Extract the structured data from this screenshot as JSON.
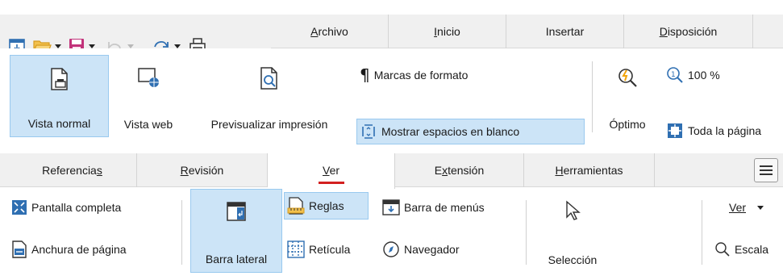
{
  "top": {
    "tabs": [
      {
        "label": "Archivo",
        "u": "A",
        "rest": "rchivo"
      },
      {
        "label": "Inicio",
        "u": "I",
        "rest": "nicio"
      },
      {
        "label": "Insertar",
        "u": "",
        "rest": "Insertar"
      },
      {
        "label": "Disposición",
        "u": "D",
        "rest": "isposición"
      }
    ],
    "buttons": {
      "vista_normal": "Vista normal",
      "vista_web": "Vista web",
      "previsualizar": "Previsualizar impresión",
      "marcas": "Marcas de formato",
      "espacios": "Mostrar espacios en blanco",
      "optimo": "Óptimo",
      "zoom": "100 %",
      "toda_pagina": "Toda la página"
    }
  },
  "bottom": {
    "tabs": [
      {
        "label": "Referencias",
        "pre": "Referencia",
        "u": "s",
        "rest": ""
      },
      {
        "label": "Revisión",
        "pre": "",
        "u": "R",
        "rest": "evisión"
      },
      {
        "label": "Ver",
        "pre": "",
        "u": "V",
        "rest": "er"
      },
      {
        "label": "Extensión",
        "pre": "E",
        "u": "x",
        "rest": "tensión"
      },
      {
        "label": "Herramientas",
        "pre": "",
        "u": "H",
        "rest": "erramientas"
      }
    ],
    "buttons": {
      "pantalla_completa": "Pantalla completa",
      "anchura": "Anchura de página",
      "barra_lateral": "Barra lateral",
      "reglas": "Reglas",
      "reticula": "Retícula",
      "barra_menus": "Barra de menús",
      "navegador": "Navegador",
      "seleccion": "Selección",
      "ver": "Ver",
      "escala": "Escala"
    }
  },
  "colors": {
    "accent_selected": "#cce4f7",
    "active_tab_underline": "#d32020"
  }
}
